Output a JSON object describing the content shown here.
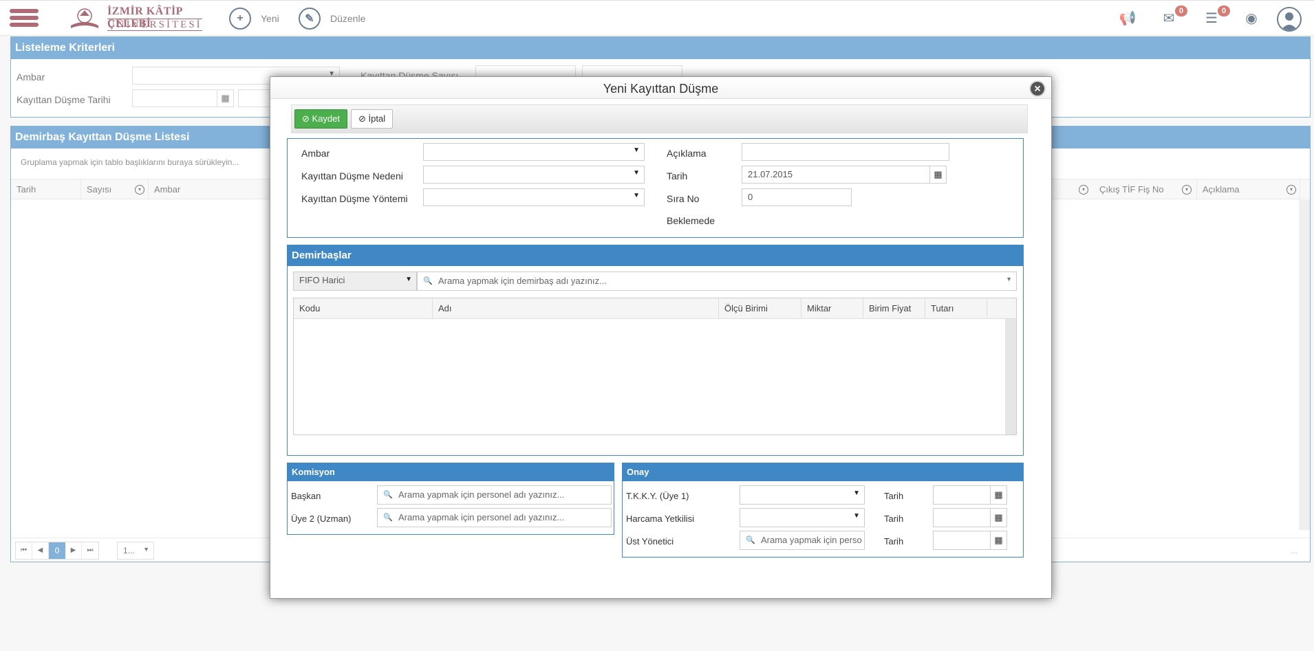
{
  "topbar": {
    "logo_line1": "İZMİR KÂTİP ÇELEBİ",
    "logo_line2": "ÜNİVERSİTESİ",
    "new_label": "Yeni",
    "edit_label": "Düzenle",
    "mail_badge": "0",
    "list_badge": "0"
  },
  "criteria": {
    "title": "Listeleme Kriterleri",
    "ambar_label": "Ambar",
    "count_label": "Kayıttan Düşme Sayısı",
    "date_label": "Kayıttan Düşme Tarihi"
  },
  "list": {
    "title": "Demirbaş Kayıttan Düşme Listesi",
    "group_hint": "Gruplama yapmak için tablo başlıklarını buraya sürükleyin...",
    "columns": [
      "Tarih",
      "Sayısı",
      "Ambar"
    ],
    "right_columns": [
      "Çıkış TİF Fiş No",
      "Açıklama"
    ],
    "pager_current": "0",
    "pager_size": "1...",
    "pager_info": "..."
  },
  "modal": {
    "title": "Yeni Kayıttan Düşme",
    "save_label": "Kaydet",
    "cancel_label": "İptal",
    "form": {
      "ambar_label": "Ambar",
      "reason_label": "Kayıttan Düşme Nedeni",
      "method_label": "Kayıttan Düşme Yöntemi",
      "desc_label": "Açıklama",
      "date_label": "Tarih",
      "date_value": "21.07.2015",
      "seq_label": "Sıra No",
      "seq_value": "0",
      "status_label": "Beklemede"
    },
    "items": {
      "title": "Demirbaşlar",
      "filter_value": "FIFO Harici",
      "search_placeholder": "Arama yapmak için demirbaş adı yazınız...",
      "columns": [
        "Kodu",
        "Adı",
        "Ölçü Birimi",
        "Miktar",
        "Birim Fiyat",
        "Tutarı"
      ]
    },
    "commission": {
      "title": "Komisyon",
      "chair_label": "Başkan",
      "member2_label": "Üye 2 (Uzman)",
      "search_placeholder": "Arama yapmak için personel adı yazınız..."
    },
    "approval": {
      "title": "Onay",
      "tkky_label": "T.K.K.Y. (Üye 1)",
      "spending_label": "Harcama Yetkilisi",
      "manager_label": "Üst Yönetici",
      "date_label": "Tarih",
      "manager_placeholder": "Arama yapmak için perso"
    }
  },
  "colors": {
    "accent": "#3f88c5",
    "brand": "#7a1b2c",
    "save": "#4cae4c"
  }
}
